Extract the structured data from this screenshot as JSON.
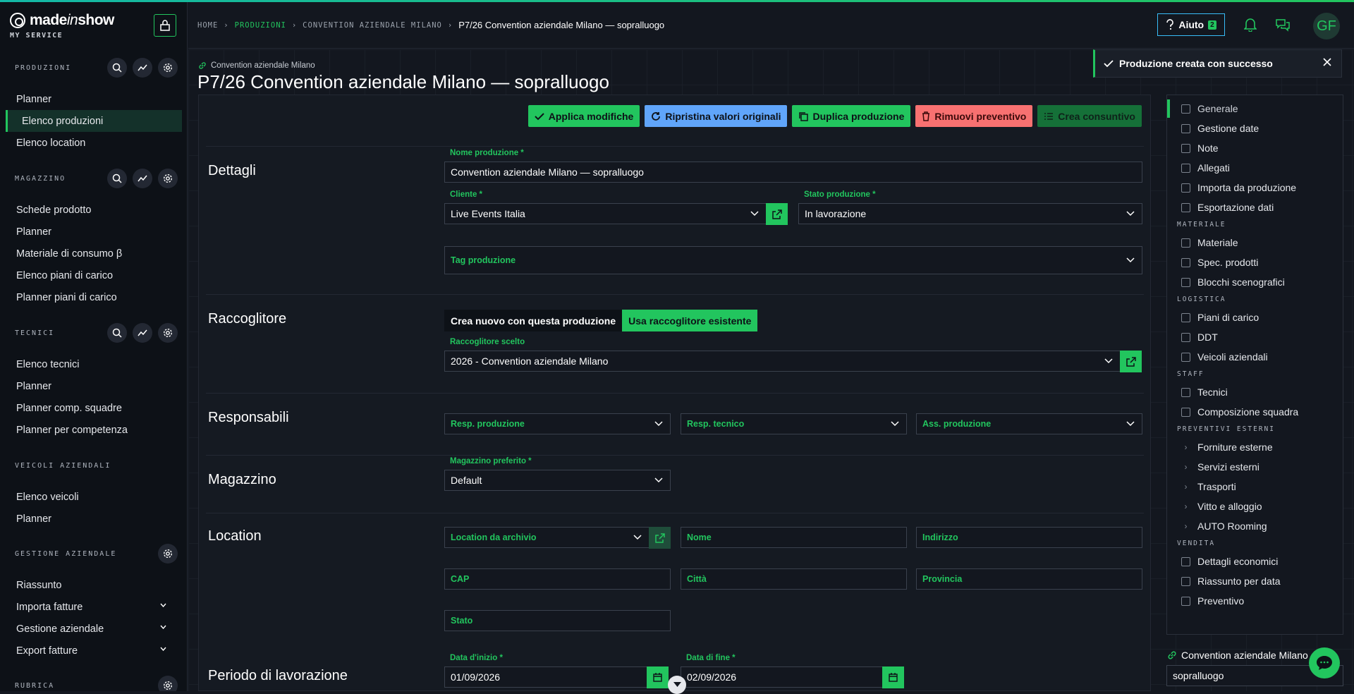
{
  "brand": {
    "name_a": "made",
    "name_b": "in",
    "name_c": "show",
    "sub": "MY SERVICE"
  },
  "sidebar": {
    "produzioni": {
      "title": "PRODUZIONI",
      "items": [
        "Planner",
        "Elenco produzioni",
        "Elenco location"
      ]
    },
    "magazzino": {
      "title": "MAGAZZINO",
      "items": [
        "Schede prodotto",
        "Planner",
        "Materiale di consumo β",
        "Elenco piani di carico",
        "Planner piani di carico"
      ]
    },
    "tecnici": {
      "title": "TECNICI",
      "items": [
        "Elenco tecnici",
        "Planner",
        "Planner comp. squadre",
        "Planner per competenza"
      ]
    },
    "veicoli": {
      "title": "VEICOLI AZIENDALI",
      "items": [
        "Elenco veicoli",
        "Planner"
      ]
    },
    "gestione": {
      "title": "GESTIONE AZIENDALE",
      "items": [
        "Riassunto",
        "Importa fatture",
        "Gestione aziendale",
        "Export fatture"
      ]
    },
    "rubrica": {
      "title": "RUBRICA"
    }
  },
  "breadcrumb": {
    "home": "HOME",
    "produzioni": "PRODUZIONI",
    "convention": "CONVENTION AZIENDALE MILANO",
    "current": "P7/26 Convention aziendale Milano — sopralluogo"
  },
  "topbar": {
    "help_label": "Aiuto",
    "help_badge": "2",
    "avatar": "GF"
  },
  "page": {
    "parent_link": "Convention aziendale Milano",
    "title": "P7/26 Convention aziendale Milano — sopralluogo"
  },
  "actions": {
    "apply": "Applica modifiche",
    "restore": "Ripristina valori originali",
    "duplicate": "Duplica produzione",
    "remove_quote": "Rimuovi preventivo",
    "create_final": "Crea consuntivo"
  },
  "dettagli": {
    "title": "Dettagli",
    "name_label": "Nome produzione *",
    "name_value": "Convention aziendale Milano — sopralluogo",
    "client_label": "Cliente *",
    "client_value": "Live Events Italia",
    "state_label": "Stato produzione *",
    "state_value": "In lavorazione",
    "tags_label": "Tag produzione"
  },
  "raccoglitore": {
    "title": "Raccoglitore",
    "opt_new": "Crea nuovo con questa produzione",
    "opt_existing": "Usa raccoglitore esistente",
    "chosen_label": "Raccoglitore scelto",
    "chosen_value": "2026 - Convention aziendale Milano"
  },
  "responsabili": {
    "title": "Responsabili",
    "resp_prod": "Resp. produzione",
    "resp_tec": "Resp. tecnico",
    "ass_prod": "Ass. produzione"
  },
  "magazzino": {
    "title": "Magazzino",
    "label": "Magazzino preferito *",
    "value": "Default"
  },
  "location": {
    "title": "Location",
    "archive": "Location da archivio",
    "nome": "Nome",
    "indirizzo": "Indirizzo",
    "cap": "CAP",
    "citta": "Città",
    "provincia": "Provincia",
    "stato": "Stato"
  },
  "periodo": {
    "title": "Periodo di lavorazione",
    "start_label": "Data d'inizio *",
    "start_value": "01/09/2026",
    "end_label": "Data di fine *",
    "end_value": "02/09/2026"
  },
  "toast": {
    "message": "Produzione creata con successo"
  },
  "rightnav": {
    "general": [
      "Generale",
      "Gestione date",
      "Note",
      "Allegati",
      "Importa da produzione",
      "Esportazione dati"
    ],
    "materiale_h": "MATERIALE",
    "materiale": [
      "Materiale",
      "Spec. prodotti",
      "Blocchi scenografici"
    ],
    "logistica_h": "LOGISTICA",
    "logistica": [
      "Piani di carico",
      "DDT",
      "Veicoli aziendali"
    ],
    "staff_h": "STAFF",
    "staff": [
      "Tecnici",
      "Composizione squadra"
    ],
    "prev_h": "PREVENTIVI ESTERNI",
    "prev": [
      "Forniture esterne",
      "Servizi esterni",
      "Trasporti",
      "Vitto e alloggio",
      "AUTO Rooming"
    ],
    "vendita_h": "VENDITA",
    "vendita": [
      "Dettagli economici",
      "Riassunto per data",
      "Preventivo"
    ]
  },
  "bottom_right": {
    "link": "Convention aziendale Milano",
    "input_value": "sopralluogo"
  }
}
